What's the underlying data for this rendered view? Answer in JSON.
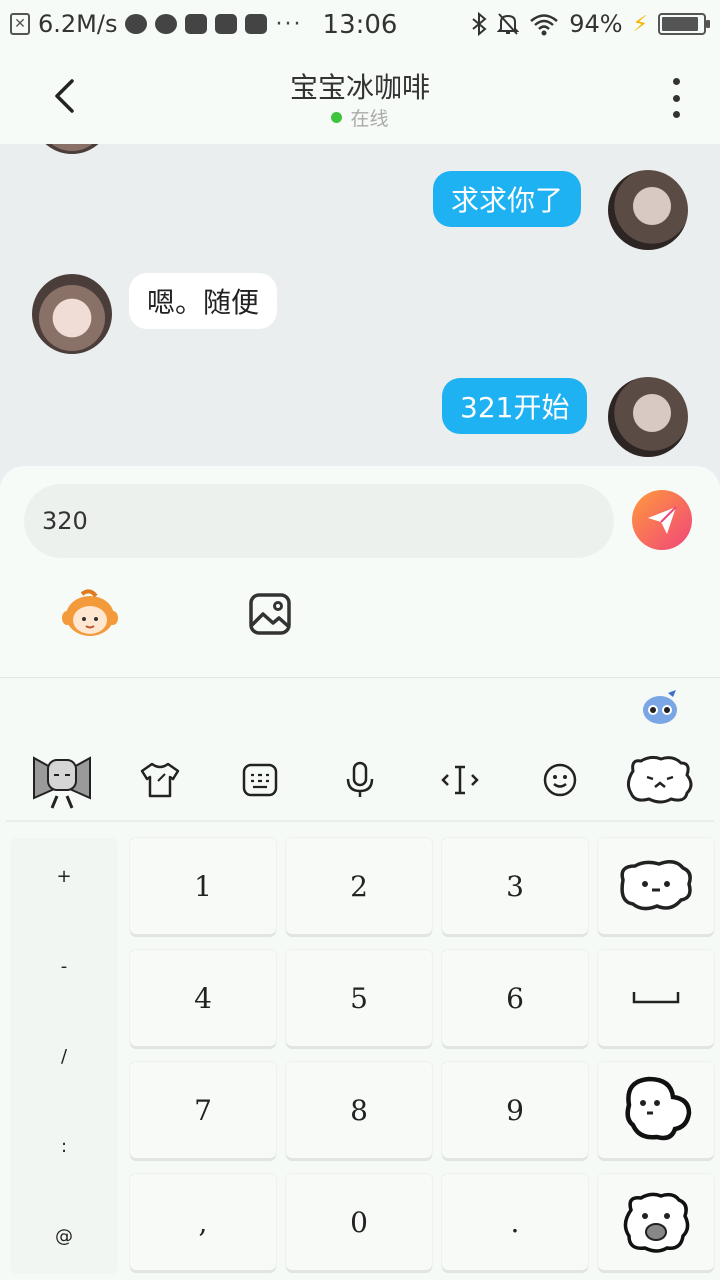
{
  "status_bar": {
    "speed": "6.2M/s",
    "time": "13:06",
    "battery": "94%",
    "dots": "···"
  },
  "header": {
    "title": "宝宝冰咖啡",
    "status": "在线"
  },
  "messages": [
    {
      "side": "me",
      "text": "求求你了"
    },
    {
      "side": "them",
      "text": "嗯。随便"
    },
    {
      "side": "me",
      "text": "321开始"
    }
  ],
  "composer": {
    "value": "320"
  },
  "keyboard": {
    "symbols": [
      "+",
      "-",
      "/",
      ":",
      "@"
    ],
    "keys": [
      [
        "1",
        "2",
        "3"
      ],
      [
        "4",
        "5",
        "6"
      ],
      [
        "7",
        "8",
        "9"
      ],
      [
        ",",
        "0",
        "."
      ]
    ],
    "space_key": "⎵"
  },
  "colors": {
    "accent": "#1fb2f2",
    "online": "#3dc53d",
    "send_start": "#ff9a3c",
    "send_end": "#f0457a"
  }
}
